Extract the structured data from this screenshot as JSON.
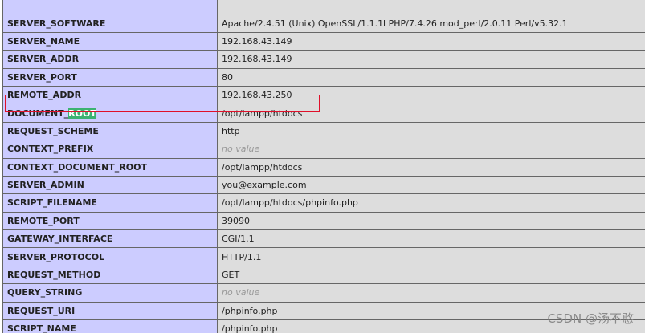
{
  "table": {
    "rows": [
      {
        "key": "SERVER_SOFTWARE",
        "value": "Apache/2.4.51 (Unix) OpenSSL/1.1.1l PHP/7.4.26 mod_perl/2.0.11 Perl/v5.32.1"
      },
      {
        "key": "SERVER_NAME",
        "value": "192.168.43.149"
      },
      {
        "key": "SERVER_ADDR",
        "value": "192.168.43.149"
      },
      {
        "key": "SERVER_PORT",
        "value": "80"
      },
      {
        "key": "REMOTE_ADDR",
        "value": "192.168.43.250"
      },
      {
        "key_prefix": "DOCUMENT_",
        "key_highlight": "ROOT",
        "value": "/opt/lampp/htdocs"
      },
      {
        "key": "REQUEST_SCHEME",
        "value": "http"
      },
      {
        "key": "CONTEXT_PREFIX",
        "value": "no value"
      },
      {
        "key": "CONTEXT_DOCUMENT_ROOT",
        "value": "/opt/lampp/htdocs"
      },
      {
        "key": "SERVER_ADMIN",
        "value": "you@example.com"
      },
      {
        "key": "SCRIPT_FILENAME",
        "value": "/opt/lampp/htdocs/phpinfo.php"
      },
      {
        "key": "REMOTE_PORT",
        "value": "39090"
      },
      {
        "key": "GATEWAY_INTERFACE",
        "value": "CGI/1.1"
      },
      {
        "key": "SERVER_PROTOCOL",
        "value": "HTTP/1.1"
      },
      {
        "key": "REQUEST_METHOD",
        "value": "GET"
      },
      {
        "key": "QUERY_STRING",
        "value": "no value"
      },
      {
        "key": "REQUEST_URI",
        "value": "/phpinfo.php"
      },
      {
        "key": "SCRIPT_NAME",
        "value": "/phpinfo.php"
      }
    ]
  },
  "watermark": "CSDN @汤不憨",
  "colors": {
    "key_cell": "#ccccff",
    "value_cell": "#dddddd",
    "highlight": "#3cb371",
    "annotation_box": "#e0102a"
  }
}
